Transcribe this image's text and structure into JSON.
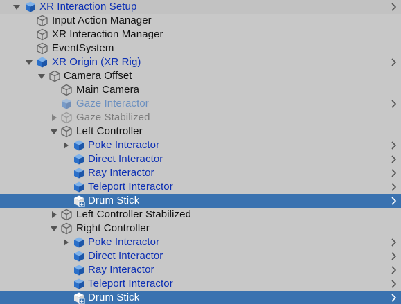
{
  "hierarchy": {
    "rows": [
      {
        "label": "XR Interaction Setup"
      },
      {
        "label": "Input Action Manager"
      },
      {
        "label": "XR Interaction Manager"
      },
      {
        "label": "EventSystem"
      },
      {
        "label": "XR Origin (XR Rig)"
      },
      {
        "label": "Camera Offset"
      },
      {
        "label": "Main Camera"
      },
      {
        "label": "Gaze Interactor"
      },
      {
        "label": "Gaze Stabilized"
      },
      {
        "label": "Left Controller"
      },
      {
        "label": "Poke Interactor"
      },
      {
        "label": "Direct Interactor"
      },
      {
        "label": "Ray Interactor"
      },
      {
        "label": "Teleport Interactor"
      },
      {
        "label": "Drum Stick"
      },
      {
        "label": "Left Controller Stabilized"
      },
      {
        "label": "Right Controller"
      },
      {
        "label": "Poke Interactor"
      },
      {
        "label": "Direct Interactor"
      },
      {
        "label": "Ray Interactor"
      },
      {
        "label": "Teleport Interactor"
      },
      {
        "label": "Drum Stick"
      }
    ]
  },
  "colors": {
    "background": "#c8c8c8",
    "selection": "#3a72b0",
    "prefab_text": "#0c2fb3",
    "prefab_icon": "#2f78d0"
  },
  "icons": {
    "prefab": "prefab-cube-icon",
    "gameobject": "gameobject-cube-outline-icon",
    "new_prefab": "prefab-cube-plus-icon",
    "expand": "chevron-right-icon"
  }
}
